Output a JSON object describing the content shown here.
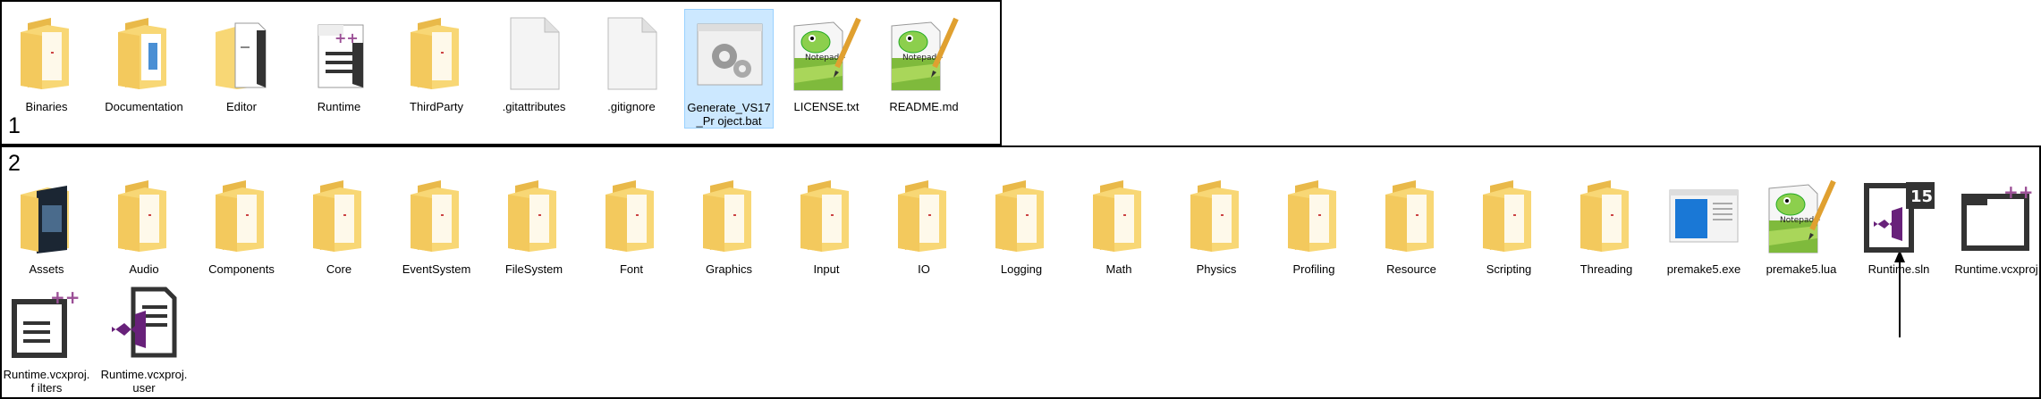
{
  "panel1": {
    "label": "1",
    "items": [
      {
        "label": "Binaries",
        "icon": "folder-icon"
      },
      {
        "label": "Documentation",
        "icon": "folder-docs-icon"
      },
      {
        "label": "Editor",
        "icon": "folder-file-icon"
      },
      {
        "label": "Runtime",
        "icon": "folder-cpp-icon"
      },
      {
        "label": "ThirdParty",
        "icon": "folder-icon"
      },
      {
        "label": ".gitattributes",
        "icon": "blank-file-icon"
      },
      {
        "label": ".gitignore",
        "icon": "blank-file-icon"
      },
      {
        "label": "Generate_VS17_Pr oject.bat",
        "icon": "batch-gear-icon",
        "selected": true
      },
      {
        "label": "LICENSE.txt",
        "icon": "notepadpp-icon"
      },
      {
        "label": "README.md",
        "icon": "notepadpp-icon"
      }
    ]
  },
  "panel2": {
    "label": "2",
    "items": [
      {
        "label": "Assets",
        "icon": "folder-assets-icon"
      },
      {
        "label": "Audio",
        "icon": "folder-icon"
      },
      {
        "label": "Components",
        "icon": "folder-icon"
      },
      {
        "label": "Core",
        "icon": "folder-icon"
      },
      {
        "label": "EventSystem",
        "icon": "folder-icon"
      },
      {
        "label": "FileSystem",
        "icon": "folder-icon"
      },
      {
        "label": "Font",
        "icon": "folder-icon"
      },
      {
        "label": "Graphics",
        "icon": "folder-icon"
      },
      {
        "label": "Input",
        "icon": "folder-icon"
      },
      {
        "label": "IO",
        "icon": "folder-icon"
      },
      {
        "label": "Logging",
        "icon": "folder-icon"
      },
      {
        "label": "Math",
        "icon": "folder-icon"
      },
      {
        "label": "Physics",
        "icon": "folder-icon"
      },
      {
        "label": "Profiling",
        "icon": "folder-icon"
      },
      {
        "label": "Resource",
        "icon": "folder-icon"
      },
      {
        "label": "Scripting",
        "icon": "folder-icon"
      },
      {
        "label": "Threading",
        "icon": "folder-icon"
      },
      {
        "label": "premake5.exe",
        "icon": "exe-window-icon"
      },
      {
        "label": "premake5.lua",
        "icon": "notepadpp-icon"
      },
      {
        "label": "Runtime.sln",
        "icon": "vs-solution-icon"
      },
      {
        "label": "Runtime.vcxproj",
        "icon": "vcxproj-icon"
      },
      {
        "label": "Runtime.vcxproj.f ilters",
        "icon": "vcxproj-filters-icon"
      },
      {
        "label": "Runtime.vcxproj. user",
        "icon": "vcxproj-user-icon"
      }
    ]
  },
  "colors": {
    "folder": "#f8d775",
    "folder_dark": "#e9b949",
    "selection": "#cce8ff",
    "vs_purple": "#68217a",
    "cpp_purple": "#9b4f96"
  }
}
